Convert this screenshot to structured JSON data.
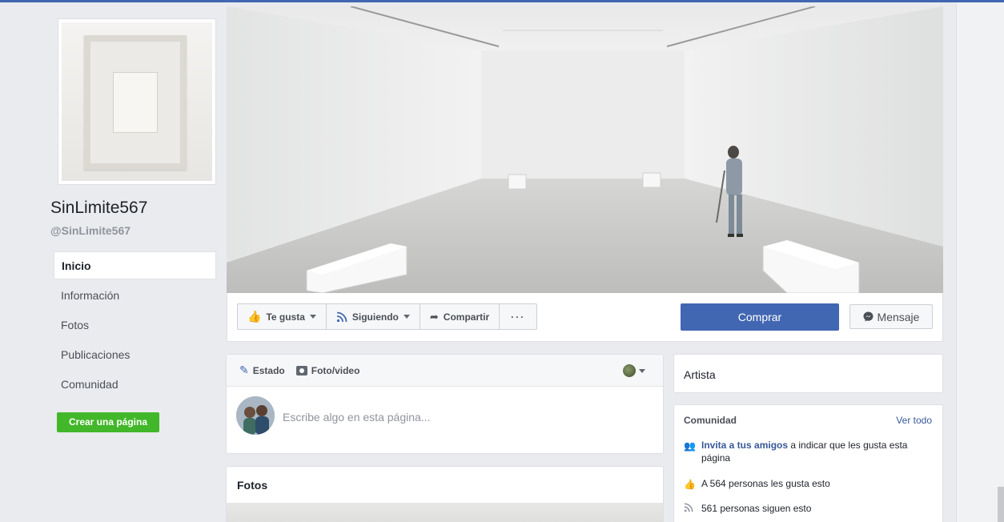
{
  "page": {
    "name": "SinLimite567",
    "handle": "@SinLimite567"
  },
  "nav": [
    {
      "label": "Inicio",
      "active": true
    },
    {
      "label": "Información",
      "active": false
    },
    {
      "label": "Fotos",
      "active": false
    },
    {
      "label": "Publicaciones",
      "active": false
    },
    {
      "label": "Comunidad",
      "active": false
    }
  ],
  "create_page_button": "Crear una página",
  "actions": {
    "like": "Te gusta",
    "following": "Siguiendo",
    "share": "Compartir",
    "more": "···",
    "buy": "Comprar",
    "message": "Mensaje"
  },
  "composer": {
    "tab_status": "Estado",
    "tab_photo": "Foto/video",
    "placeholder": "Escribe algo en esta página..."
  },
  "photos_section": {
    "title": "Fotos"
  },
  "category": "Artista",
  "community": {
    "heading": "Comunidad",
    "see_all": "Ver todo",
    "invite_link": "Invita a tus amigos",
    "invite_rest": " a indicar que les gusta esta página",
    "likes": "A 564 personas les gusta esto",
    "follows": "561 personas siguen esto"
  },
  "colors": {
    "brand_blue": "#4267b2",
    "create_green": "#42b72a",
    "link_blue": "#385898"
  }
}
